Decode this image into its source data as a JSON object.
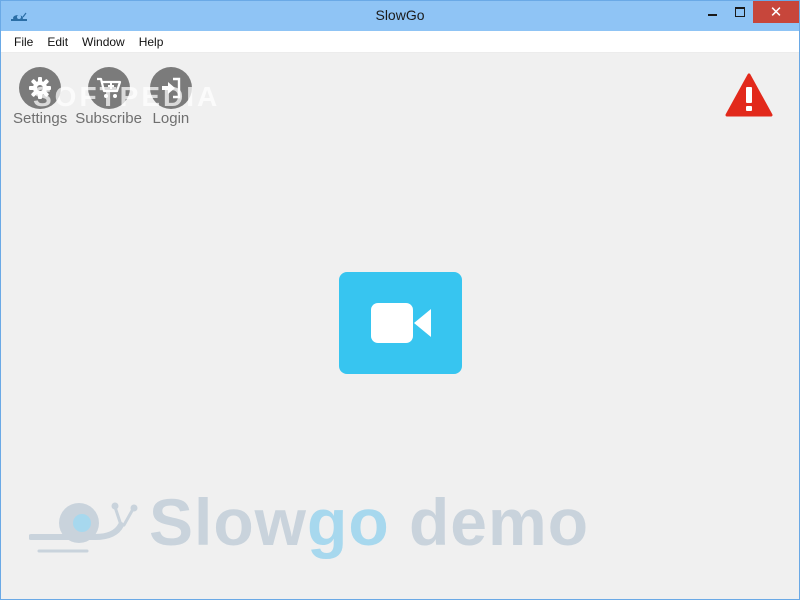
{
  "window": {
    "title": "SlowGo"
  },
  "menu": {
    "items": [
      "File",
      "Edit",
      "Window",
      "Help"
    ]
  },
  "toolbar": {
    "settings_label": "Settings",
    "subscribe_label": "Subscribe",
    "login_label": "Login"
  },
  "watermark": {
    "text": "SOFTPEDIA"
  },
  "logo": {
    "part1": "Slow",
    "part2": "go",
    "part3": " demo"
  },
  "icons": {
    "settings": "gear-icon",
    "subscribe": "cart-plus-icon",
    "login": "sign-in-icon",
    "warning": "warning-triangle-icon",
    "video": "video-camera-icon"
  },
  "colors": {
    "titlebar": "#8fc4f5",
    "close_button": "#c7463b",
    "toolbar_icon": "#7b7b7b",
    "video_button": "#37c5f0",
    "warning": "#e2291b",
    "logo_text": "#c9d3dc",
    "logo_accent": "#a7d8ee"
  }
}
